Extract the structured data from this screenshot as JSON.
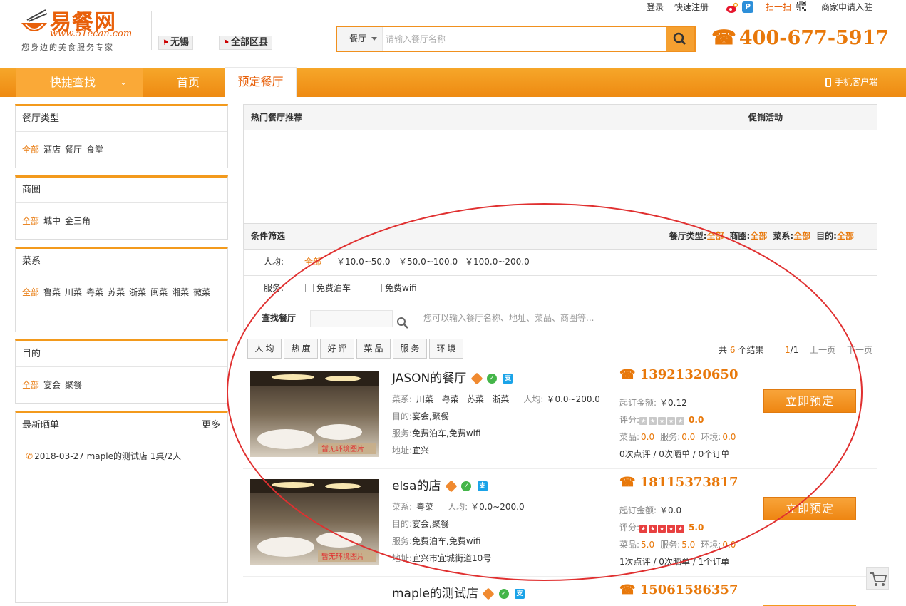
{
  "header": {
    "logo_title": "易餐网",
    "logo_url": "www.51ecan.com",
    "logo_slogan": "您身边的美食服务专家",
    "city": "无锡",
    "district": "全部区县",
    "top_links": {
      "login": "登录",
      "register": "快速注册",
      "scan": "扫一扫",
      "merchant": "商家申请入驻"
    },
    "search": {
      "category": "餐厅",
      "placeholder": "请输入餐厅名称"
    },
    "hotline": "400-677-5917"
  },
  "nav": {
    "quick": "快捷查找",
    "home": "首页",
    "book": "预定餐厅",
    "mobile": "手机客户端"
  },
  "sidebar": {
    "type": {
      "title": "餐厅类型",
      "items": [
        "全部",
        "酒店",
        "餐厅",
        "食堂"
      ]
    },
    "area": {
      "title": "商圈",
      "items": [
        "全部",
        "城中",
        "金三角"
      ]
    },
    "cuisine": {
      "title": "菜系",
      "items": [
        "全部",
        "鲁菜",
        "川菜",
        "粤菜",
        "苏菜",
        "浙菜",
        "闽菜",
        "湘菜",
        "徽菜"
      ]
    },
    "purpose": {
      "title": "目的",
      "items": [
        "全部",
        "宴会",
        "聚餐"
      ]
    },
    "showcase": {
      "title": "最新晒单",
      "more": "更多",
      "entry": "2018-03-27  maple的测试店  1桌/2人"
    }
  },
  "main": {
    "hot_title": "热门餐厅推荐",
    "promo_title": "促销活动",
    "filter_title": "条件筛选",
    "filter_summary": {
      "type_label": "餐厅类型:",
      "type_val": "全部",
      "area_label": "商圈:",
      "area_val": "全部",
      "cuisine_label": "菜系:",
      "cuisine_val": "全部",
      "purpose_label": "目的:",
      "purpose_val": "全部"
    },
    "price": {
      "label": "人均:",
      "options": [
        "全部",
        "￥10.0~50.0",
        "￥50.0~100.0",
        "￥100.0~200.0"
      ]
    },
    "service": {
      "label": "服务:",
      "options": [
        "免费泊车",
        "免费wifi"
      ]
    },
    "find": {
      "label": "查找餐厅",
      "hint": "您可以输入餐厅名称、地址、菜品、商圈等..."
    },
    "sort": [
      "人均",
      "热度",
      "好评",
      "菜品",
      "服务",
      "环境"
    ],
    "results": {
      "prefix": "共",
      "count": "6",
      "suffix": "个结果",
      "page": "1",
      "total": "/1",
      "prev": "上一页",
      "next": "下一页"
    },
    "img_caption": "暂无环境图片",
    "restaurants": [
      {
        "name": "JASON的餐厅",
        "cuisine_label": "菜系:",
        "cuisine": "川菜   粤菜   苏菜   浙菜",
        "price_label": "人均:",
        "price": "￥0.0~200.0",
        "purpose_label": "目的:",
        "purpose": "宴会,聚餐",
        "service_label": "服务:",
        "service": "免费泊车,免费wifi",
        "addr_label": "地址:",
        "addr": "宜兴",
        "phone": "13921320650",
        "min_label": "起订金额:",
        "min": "￥0.12",
        "rating_label": "评分:",
        "rating": "0.0",
        "stars": 0,
        "dish_label": "菜品:",
        "dish": "0.0",
        "svc_label": "服务:",
        "svc": "0.0",
        "env_label": "环境:",
        "env": "0.0",
        "stats": "0次点评 / 0次晒单 / 0个订单",
        "book": "立即预定"
      },
      {
        "name": "elsa的店",
        "cuisine_label": "菜系:",
        "cuisine": "粤菜",
        "price_label": "人均:",
        "price": "￥0.0~200.0",
        "purpose_label": "目的:",
        "purpose": "宴会,聚餐",
        "service_label": "服务:",
        "service": "免费泊车,免费wifi",
        "addr_label": "地址:",
        "addr": "宜兴市宜城街道10号",
        "phone": "18115373817",
        "min_label": "起订金额:",
        "min": "￥0.0",
        "rating_label": "评分:",
        "rating": "5.0",
        "stars": 5,
        "dish_label": "菜品:",
        "dish": "5.0",
        "svc_label": "服务:",
        "svc": "5.0",
        "env_label": "环境:",
        "env": "0.0",
        "stats": "1次点评 / 0次晒单 / 1个订单",
        "book": "立即预定"
      },
      {
        "name": "maple的测试店",
        "phone": "15061586357"
      }
    ]
  },
  "colors": {
    "accent": "#f39a1c",
    "brand": "#e8600a",
    "ellipse": "#e03030"
  }
}
